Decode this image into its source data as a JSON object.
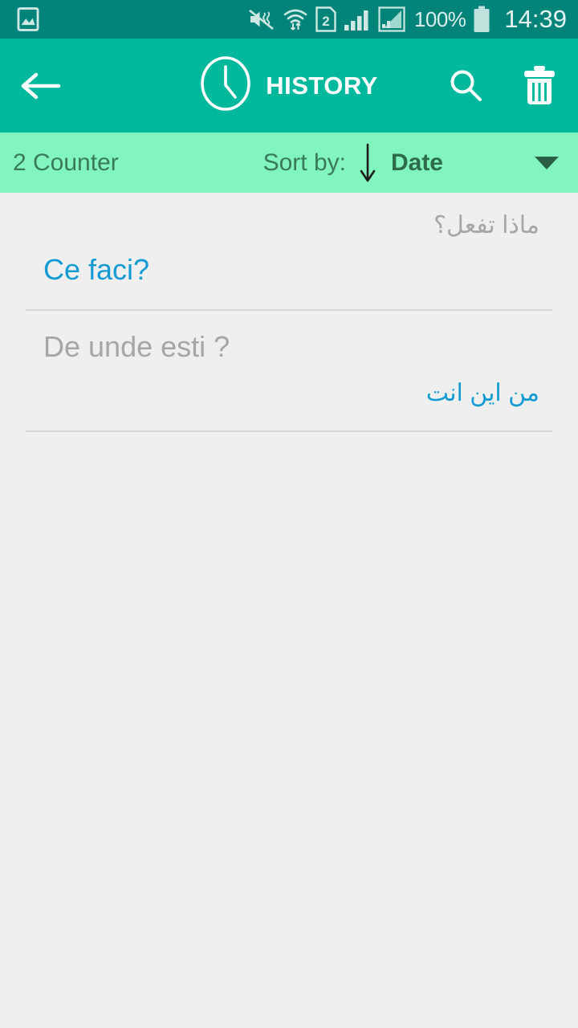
{
  "status_bar": {
    "background_color": "#00847a",
    "icons": [
      "image-gallery-icon",
      "vibrate-mute-icon",
      "wifi-transfer-icon",
      "sim2-icon",
      "signal-bars-icon",
      "data-signal-icon"
    ],
    "battery_percent": "100%",
    "time": "14:39"
  },
  "app_bar": {
    "background_color": "#00b89c",
    "back_label": "Back",
    "clock_icon": "clock-icon",
    "title": "HISTORY",
    "search_label": "Search",
    "delete_label": "Delete all"
  },
  "sort_bar": {
    "background_color": "#81f5bd",
    "counter": "2 Counter",
    "sort_by_label": "Sort by:",
    "sort_direction": "descending",
    "sort_value": "Date",
    "dropdown_icon": "chevron-down-icon"
  },
  "history": {
    "items": [
      {
        "source_text": "ماذا تفعل؟",
        "source_dir": "rtl",
        "target_text": "Ce faci?",
        "target_dir": "ltr",
        "target_color": "#149bd3"
      },
      {
        "source_text": "De unde esti ?",
        "source_dir": "ltr",
        "target_text": "من اين انت",
        "target_dir": "rtl",
        "target_color": "#149bd3"
      }
    ]
  },
  "colors": {
    "accent_teal": "#00b89c",
    "status_teal": "#00847a",
    "mint": "#81f5bd",
    "link_blue": "#149bd3",
    "muted_gray": "#a6a6a6",
    "content_bg": "#efefef"
  }
}
